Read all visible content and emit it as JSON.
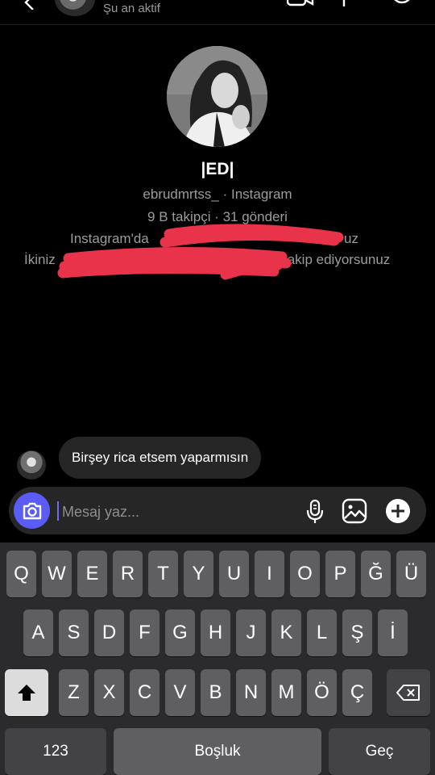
{
  "header": {
    "status": "Şu an aktif"
  },
  "profile": {
    "display_name": "|ED|",
    "handle_line": "ebrudmrtss_ · Instagram",
    "stats_line": "9 B takipçi · 31 gönderi",
    "follow_line1_start": "Instagram'da",
    "follow_line1_end": "uz",
    "follow_line2_start": "İkiniz",
    "follow_line2_end": "takip ediyorsunuz"
  },
  "messages": [
    {
      "text": "Birşey rica etsem yaparmısın"
    }
  ],
  "composer": {
    "placeholder": "Mesaj yaz..."
  },
  "keyboard": {
    "row1": [
      "Q",
      "W",
      "E",
      "R",
      "T",
      "Y",
      "U",
      "I",
      "O",
      "P",
      "Ğ",
      "Ü"
    ],
    "row2": [
      "A",
      "S",
      "D",
      "F",
      "G",
      "H",
      "J",
      "K",
      "L",
      "Ş",
      "İ"
    ],
    "row3": [
      "Z",
      "X",
      "C",
      "V",
      "B",
      "N",
      "M",
      "Ö",
      "Ç"
    ],
    "numbers_label": "123",
    "space_label": "Boşluk",
    "go_label": "Geç"
  },
  "colors": {
    "accent": "#5b5cf5",
    "redaction": "#e8334a",
    "bubble": "#262626",
    "keyboard_bg": "#2b2b2d"
  }
}
